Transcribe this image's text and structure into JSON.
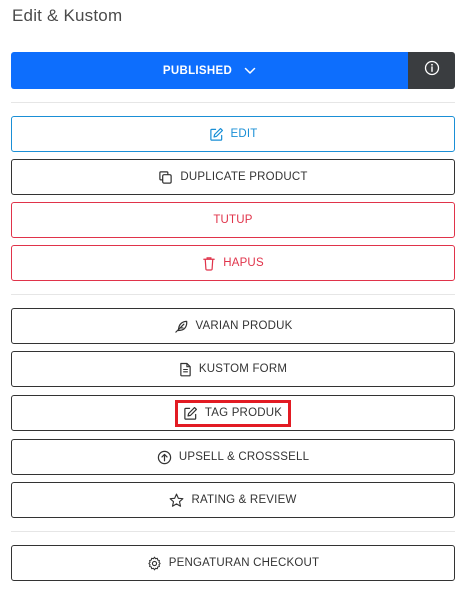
{
  "panel": {
    "title": "Edit & Kustom"
  },
  "publish": {
    "status_label": "PUBLISHED",
    "chevron_icon": "chevron-down-icon",
    "info_icon": "info-icon",
    "colors": {
      "primary": "#0d6efd",
      "dark": "#3a3d40"
    }
  },
  "actions": {
    "edit": "EDIT",
    "duplicate": "DUPLICATE PRODUCT",
    "close": "TUTUP",
    "delete": "HAPUS"
  },
  "features": {
    "variants": "VARIAN PRODUK",
    "custom_form": "KUSTOM FORM",
    "tag": "TAG PRODUK",
    "upsell": "UPSELL & CROSSSELL",
    "rating": "RATING & REVIEW"
  },
  "checkout": {
    "settings": "PENGATURAN CHECKOUT"
  },
  "highlight_color": "#e21b23"
}
